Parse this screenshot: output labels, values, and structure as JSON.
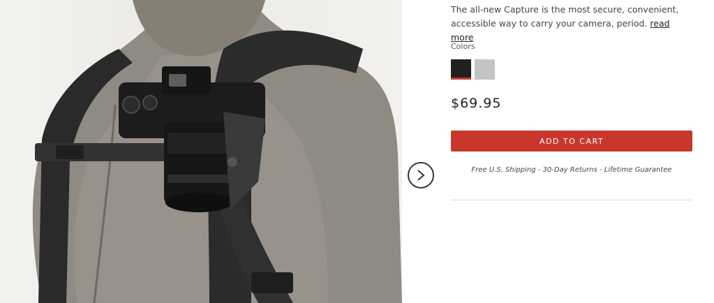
{
  "product": {
    "description": "The all-new Capture is the most secure, convenient, accessible way to carry your camera, period.",
    "read_more_label": "read more",
    "colors_label": "Colors",
    "swatches": [
      {
        "name": "Black",
        "color": "#231f20",
        "selected": true
      },
      {
        "name": "Grey",
        "color": "#c4c4c4",
        "selected": false
      }
    ],
    "price": "$69.95",
    "add_to_cart_label": "ADD TO CART",
    "shipping_note": "Free U.S. Shipping - 30-Day Returns - Lifetime Guarantee"
  },
  "icons": {
    "next": "chevron-right-icon"
  },
  "colors": {
    "accent": "#c9372c",
    "text": "#333333"
  }
}
